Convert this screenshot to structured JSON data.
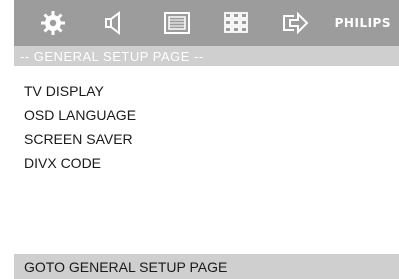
{
  "toolbar": {
    "icons": [
      "settings-icon",
      "speaker-icon",
      "display-icon",
      "grid-icon",
      "export-icon"
    ],
    "brand": "PHILIPS"
  },
  "page_header": {
    "title": "-- GENERAL SETUP PAGE --"
  },
  "menu": {
    "items": [
      {
        "label": "TV DISPLAY"
      },
      {
        "label": "OSD LANGUAGE"
      },
      {
        "label": "SCREEN SAVER"
      },
      {
        "label": "DIVX CODE"
      }
    ]
  },
  "status": {
    "text": "GOTO GENERAL SETUP PAGE"
  },
  "colors": {
    "toolbar": "#9c9c9c",
    "header_bar": "#cfcfcf",
    "status_bar": "#cfcfcf",
    "text": "#1a1a1a",
    "header_text": "#ffffff"
  }
}
